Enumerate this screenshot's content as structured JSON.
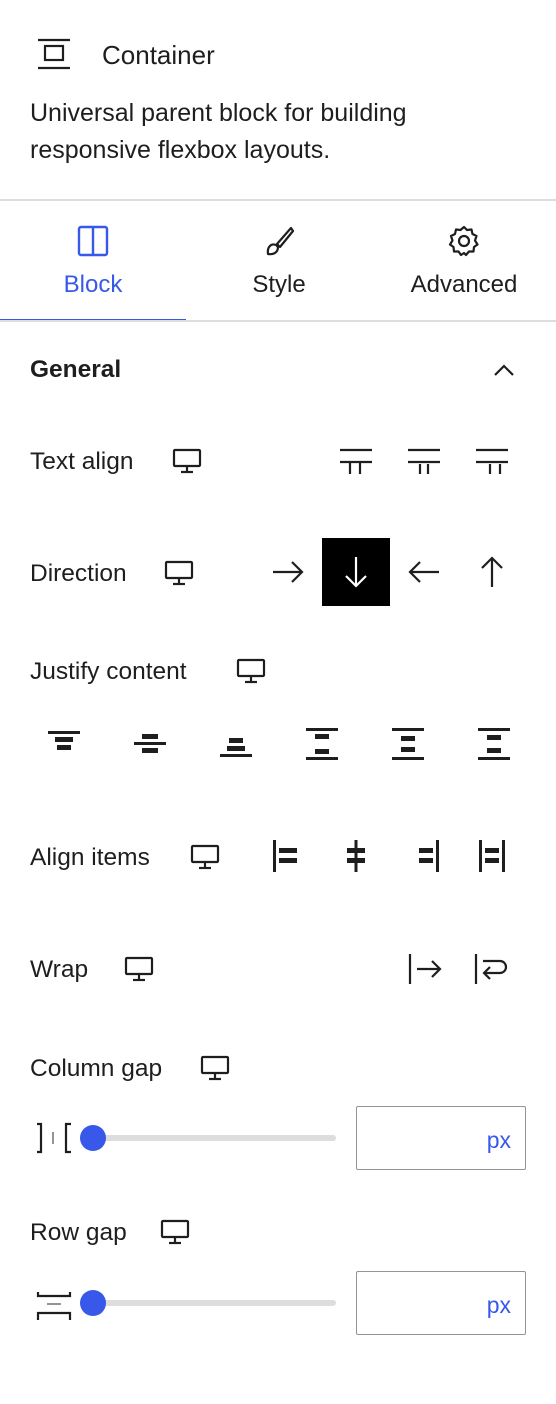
{
  "block": {
    "title": "Container",
    "icon": "container-block-icon",
    "description": "Universal parent block for building responsive flexbox layouts."
  },
  "tabs": [
    {
      "label": "Block",
      "icon": "columns-icon",
      "active": true
    },
    {
      "label": "Style",
      "icon": "brush-icon",
      "active": false
    },
    {
      "label": "Advanced",
      "icon": "gear-icon",
      "active": false
    }
  ],
  "panel": {
    "title": "General",
    "expanded": true
  },
  "controls": {
    "text_align": {
      "label": "Text align",
      "options": [
        "align-left",
        "align-center",
        "align-right"
      ],
      "selected": null
    },
    "direction": {
      "label": "Direction",
      "options": [
        "row",
        "column",
        "row-reverse",
        "column-reverse"
      ],
      "selected": "column"
    },
    "justify_content": {
      "label": "Justify content",
      "options": [
        "start",
        "center",
        "end",
        "space-between",
        "space-around",
        "space-evenly"
      ],
      "selected": null
    },
    "align_items": {
      "label": "Align items",
      "options": [
        "start",
        "center",
        "end",
        "stretch"
      ],
      "selected": null
    },
    "wrap": {
      "label": "Wrap",
      "options": [
        "nowrap",
        "wrap"
      ],
      "selected": null
    },
    "column_gap": {
      "label": "Column gap",
      "value": "",
      "unit": "px",
      "slider_value": 0
    },
    "row_gap": {
      "label": "Row gap",
      "value": "",
      "unit": "px",
      "slider_value": 0
    }
  },
  "colors": {
    "accent": "#3858e9",
    "text": "#1e1e1e",
    "divider": "#dddddd",
    "selected_bg": "#000000"
  }
}
